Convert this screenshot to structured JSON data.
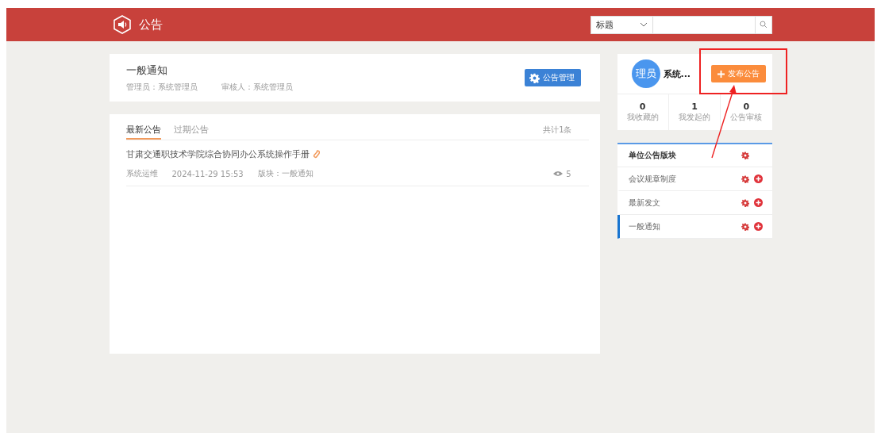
{
  "header": {
    "title": "公告",
    "search": {
      "field": "标题"
    }
  },
  "board": {
    "title": "一般通知",
    "admin": "管理员：系统管理员",
    "reviewer": "审核人：系统管理员",
    "manage_button": "公告管理"
  },
  "tabs": [
    {
      "label": "最新公告",
      "selected": true
    },
    {
      "label": "过期公告",
      "selected": false
    }
  ],
  "total": "共计1条",
  "notices": [
    {
      "title": "甘肃交通职技术学院综合协同办公系统操作手册",
      "attachment": true,
      "author": "系统运维",
      "time": "2024-11-29 15:53",
      "section": "版块：一般通知",
      "views": "5"
    }
  ],
  "user": {
    "avatar": "理员",
    "name": "系统...",
    "publish_button": "发布公告"
  },
  "stats": [
    {
      "value": "0",
      "label": "我收藏的"
    },
    {
      "value": "1",
      "label": "我发起的"
    },
    {
      "value": "0",
      "label": "公告审核"
    }
  ],
  "sections": {
    "title": "单位公告版块",
    "items": [
      {
        "label": "会议规章制度",
        "selected": false
      },
      {
        "label": "最新发文",
        "selected": false
      },
      {
        "label": "一般通知",
        "selected": true
      }
    ]
  }
}
